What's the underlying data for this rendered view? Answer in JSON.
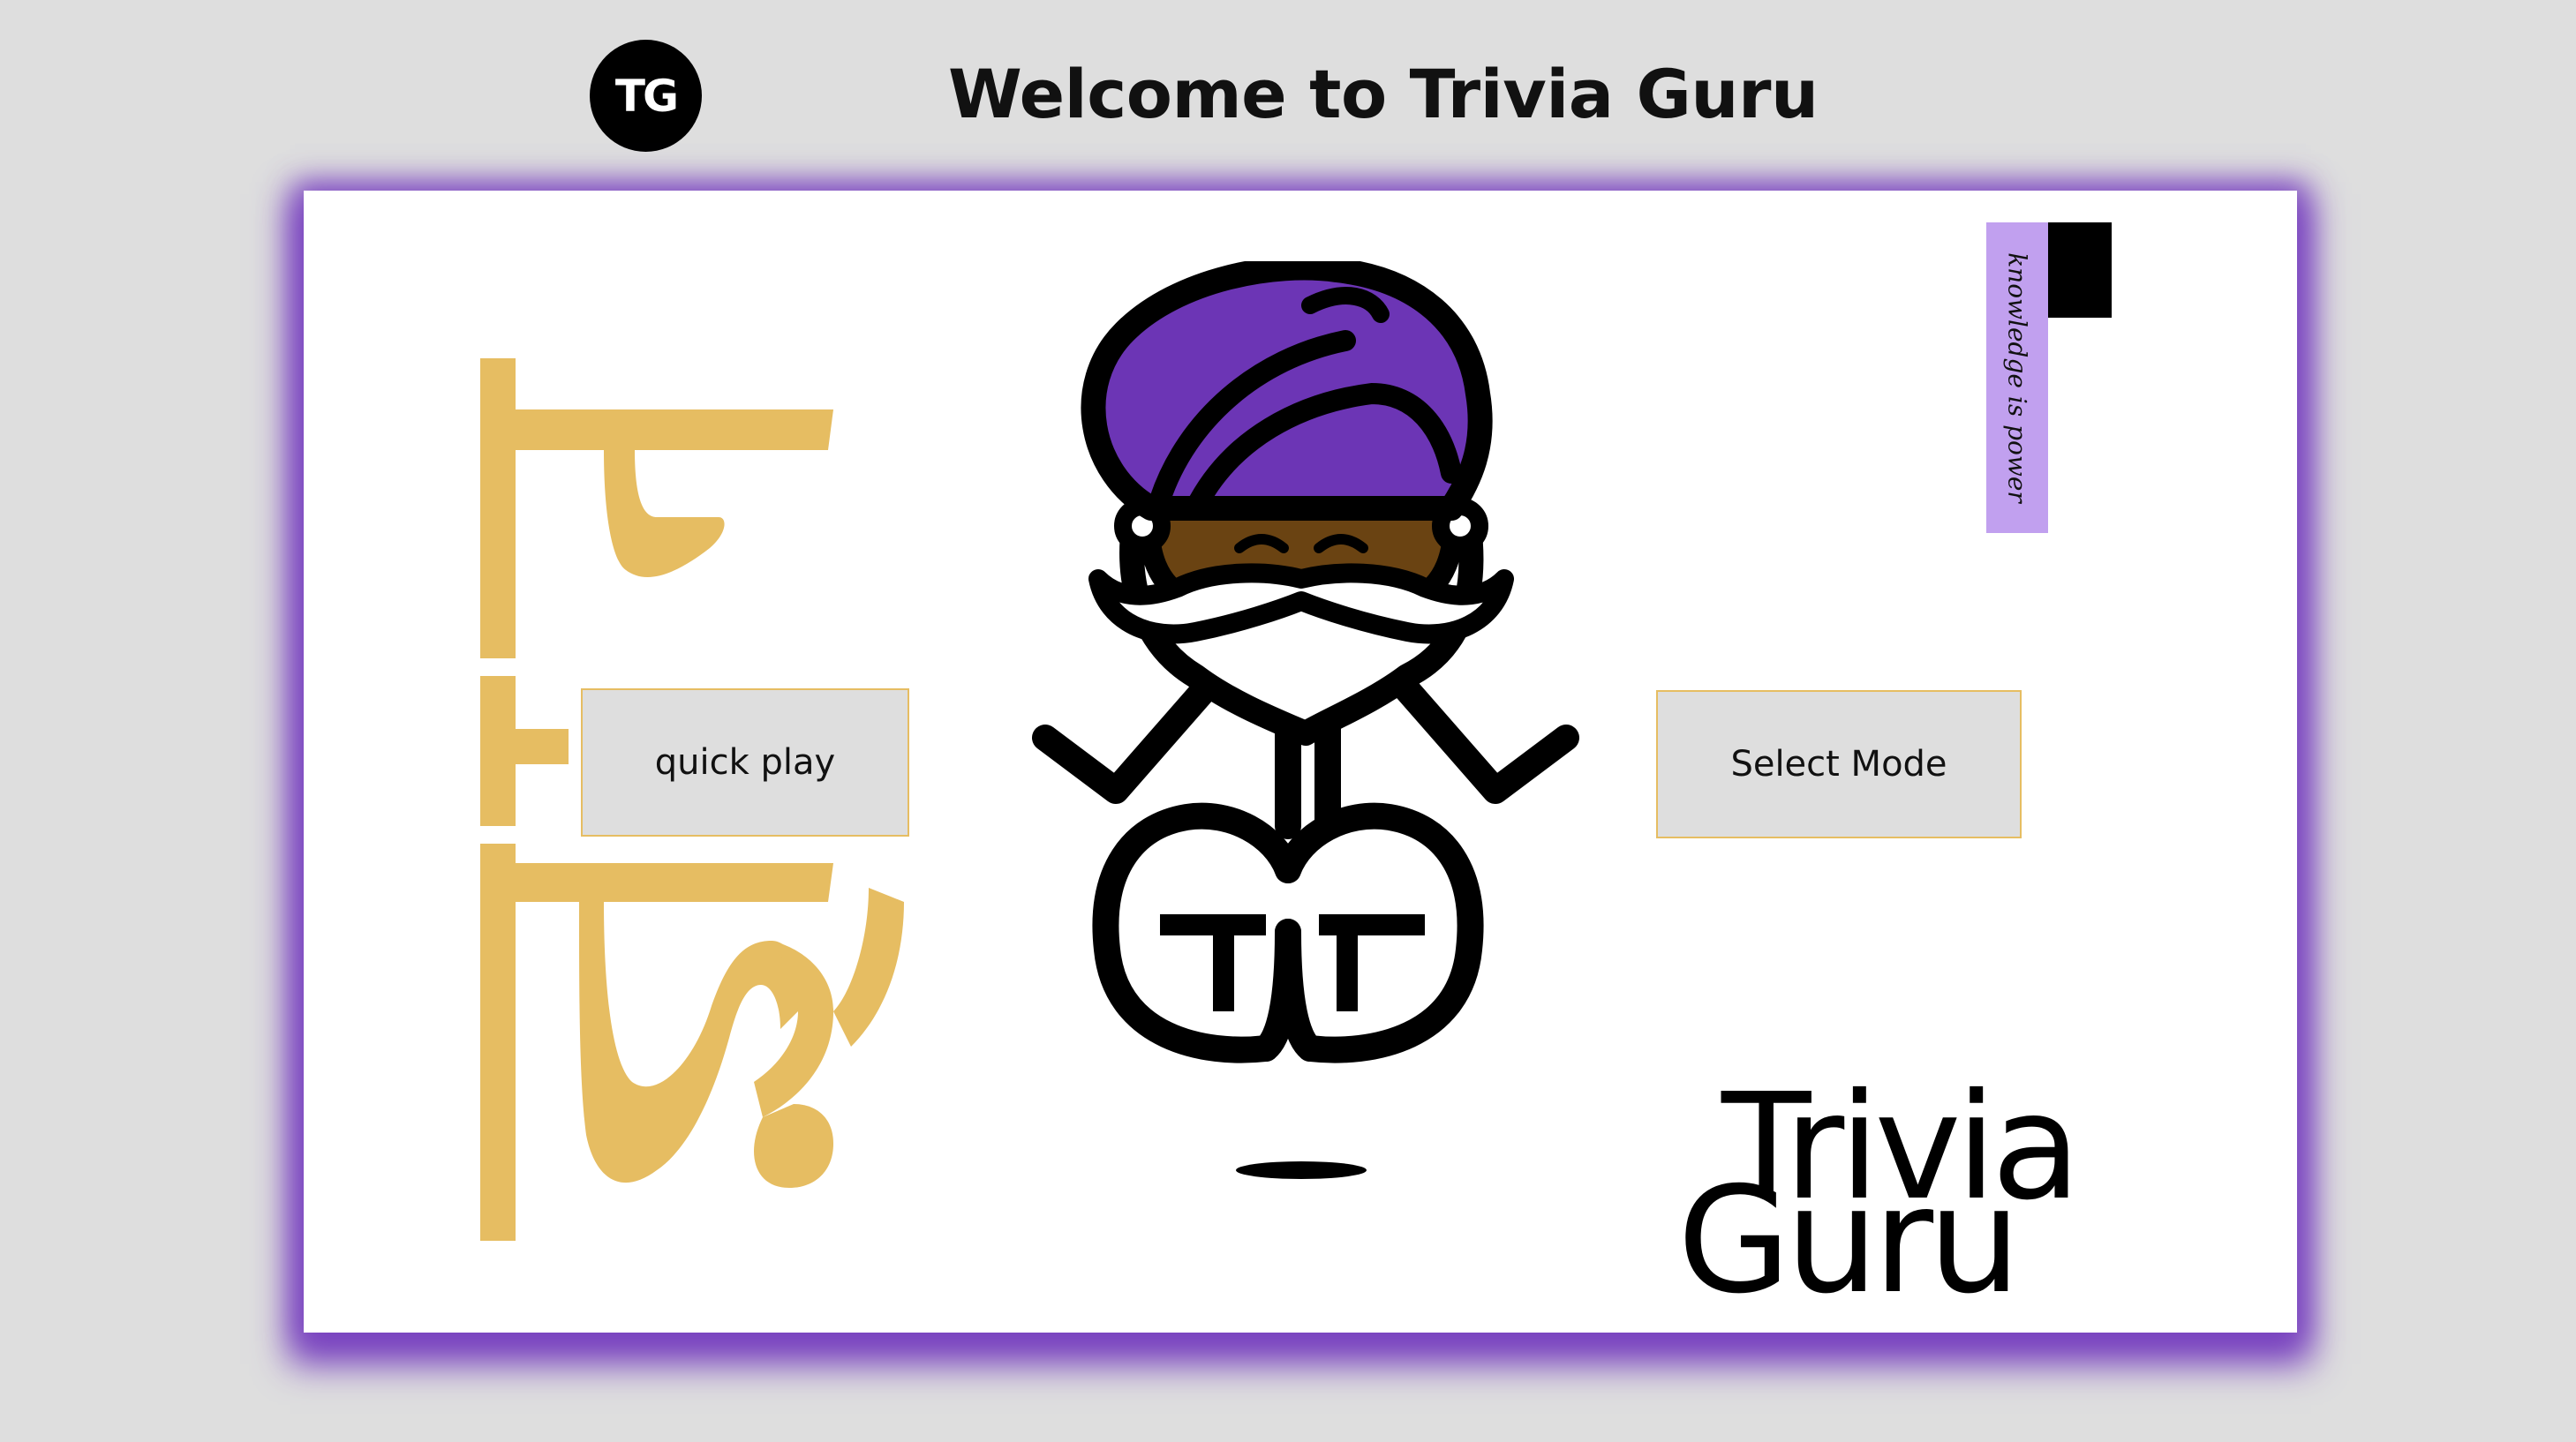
{
  "header": {
    "logo_text": "TG",
    "title": "Welcome to Trivia Guru"
  },
  "buttons": {
    "quick_play": "quick play",
    "select_mode": "Select Mode"
  },
  "tag": {
    "english": "knowledge is power",
    "hindi": "ज्ञान"
  },
  "wordmark": {
    "line1": "Trivia",
    "line2": "Guru"
  },
  "colors": {
    "accent_purple": "#7a44c0",
    "turban_purple": "#6c35b5",
    "gold": "#e6bd62",
    "skin": "#6a4312",
    "background": "#dedede"
  }
}
